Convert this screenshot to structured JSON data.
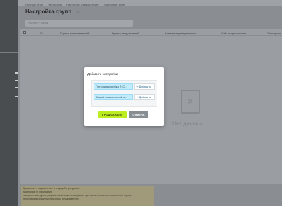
{
  "breadcrumbs": [
    "Рабочий стол",
    "Настройки",
    "Настройки уведомлений",
    "Настройки групп"
  ],
  "page": {
    "title": "Настройка групп"
  },
  "filter": {
    "placeholder": "Фильтр + поиск"
  },
  "grid": {
    "columns": [
      "ID",
      "Группа пользователей",
      "Группа уведомлений",
      "Название уведомления",
      "Сайт в приложении",
      "Электронн"
    ],
    "empty_text": "Нет данных"
  },
  "notice": {
    "lines": [
      "Прикрепите уведомление к текущей к ресурсам:",
      "настройка по умолчанию",
      "настроенная группа уведомлений может совершает при выполнении при назначении группе",
      "персонализированных настроек пользователей"
    ]
  },
  "modal": {
    "title": "Добавить настройки",
    "rows": [
      {
        "value": "Тестовая коробка 2: С...",
        "add_label": "+ Добавить"
      },
      {
        "value": "Новый комментарий к...",
        "add_label": "+ Добавить"
      }
    ],
    "continue_label": "ПРОДОЛЖИТЬ",
    "cancel_label": "ОТМЕНА"
  },
  "colors": {
    "accent": "#bbed21",
    "chip": "#c3ecfa",
    "overlay": "#8a8e92"
  }
}
